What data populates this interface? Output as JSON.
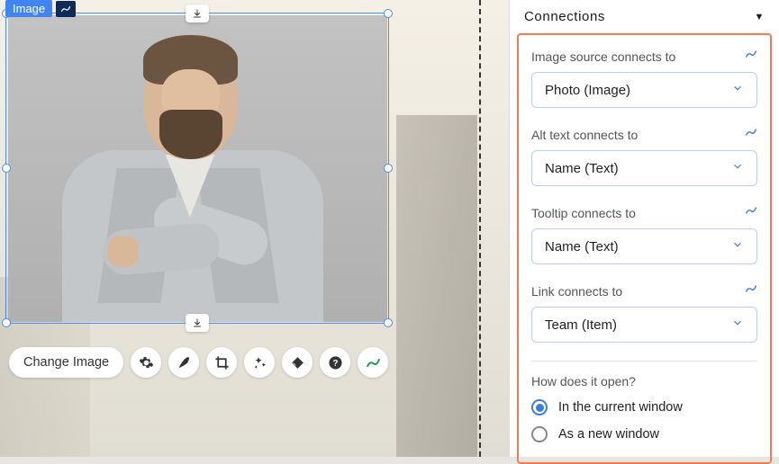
{
  "selection": {
    "tag": "Image"
  },
  "toolbar": {
    "change_image": "Change Image"
  },
  "panel": {
    "title": "Connections",
    "fields": [
      {
        "label": "Image source connects to",
        "value": "Photo (Image)"
      },
      {
        "label": "Alt text connects to",
        "value": "Name (Text)"
      },
      {
        "label": "Tooltip connects to",
        "value": "Name (Text)"
      },
      {
        "label": "Link connects to",
        "value": "Team (Item)"
      }
    ],
    "open_section": {
      "label": "How does it open?",
      "option_current": "In the current window",
      "option_new": "As a new window"
    }
  }
}
